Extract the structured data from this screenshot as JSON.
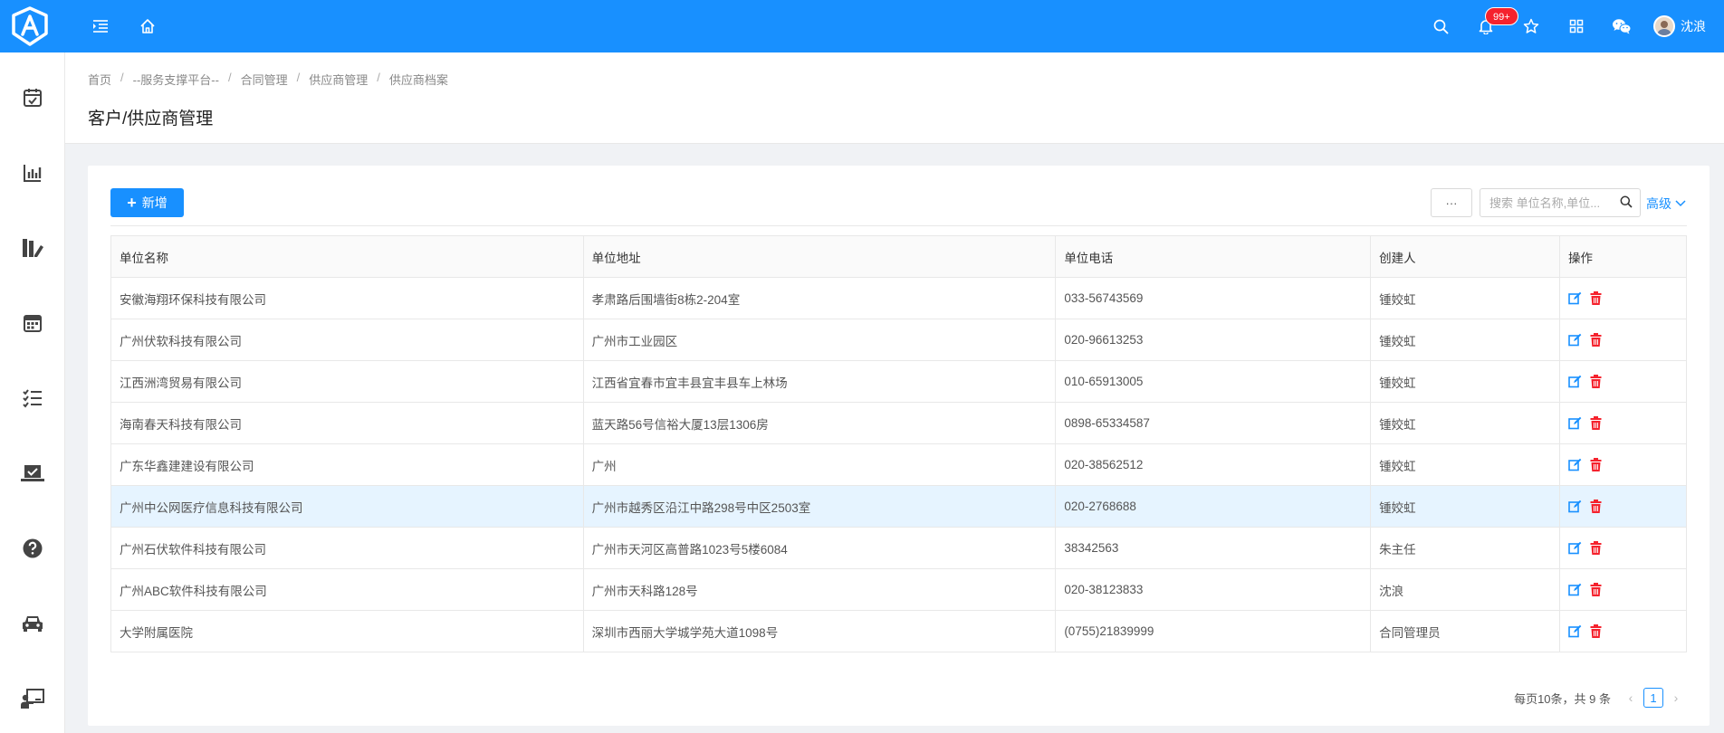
{
  "topbar": {
    "badge": "99+",
    "username": "沈浪",
    "icons": [
      "menu-fold-icon",
      "home-icon",
      "search-icon",
      "bell-icon",
      "star-icon",
      "apps-icon",
      "wechat-icon"
    ]
  },
  "sidebar": {
    "items": [
      "task-check-icon",
      "bar-chart-icon",
      "book-edit-icon",
      "calendar-icon",
      "list-check-icon",
      "laptop-check-icon",
      "help-icon",
      "car-icon",
      "teacher-icon"
    ]
  },
  "breadcrumb": [
    "首页",
    "--服务支撑平台--",
    "合同管理",
    "供应商管理",
    "供应商档案"
  ],
  "page_title": "客户/供应商管理",
  "toolbar": {
    "add_label": "新增",
    "more_label": "···",
    "search_placeholder": "搜索 单位名称,单位...",
    "advanced_label": "高级"
  },
  "table": {
    "headers": [
      "单位名称",
      "单位地址",
      "单位电话",
      "创建人",
      "操作"
    ],
    "rows": [
      {
        "name": "安徽海翔环保科技有限公司",
        "address": "孝肃路后围墙街8栋2-204室",
        "phone": "033-56743569",
        "creator": "锺姣虹"
      },
      {
        "name": "广州伏软科技有限公司",
        "address": "广州市工业园区",
        "phone": "020-96613253",
        "creator": "锺姣虹"
      },
      {
        "name": "江西洲湾贸易有限公司",
        "address": "江西省宜春市宜丰县宜丰县车上林场",
        "phone": "010-65913005",
        "creator": "锺姣虹"
      },
      {
        "name": "海南春天科技有限公司",
        "address": "蓝天路56号信裕大厦13层1306房",
        "phone": "0898-65334587",
        "creator": "锺姣虹"
      },
      {
        "name": "广东华鑫建建设有限公司",
        "address": "广州",
        "phone": "020-38562512",
        "creator": "锺姣虹"
      },
      {
        "name": "广州中公网医疗信息科技有限公司",
        "address": "广州市越秀区沿江中路298号中区2503室",
        "phone": "020-2768688",
        "creator": "锺姣虹"
      },
      {
        "name": "广州石伏软件科技有限公司",
        "address": "广州市天河区高普路1023号5楼6084",
        "phone": "38342563",
        "creator": "朱主任"
      },
      {
        "name": "广州ABC软件科技有限公司",
        "address": "广州市天科路128号",
        "phone": "020-38123833",
        "creator": "沈浪"
      },
      {
        "name": "大学附属医院",
        "address": "深圳市西丽大学城学苑大道1098号",
        "phone": "(0755)21839999",
        "creator": "合同管理员"
      }
    ],
    "highlighted_row": 5
  },
  "pagination": {
    "info": "每页10条，共 9 条",
    "current_page": "1"
  },
  "colors": {
    "primary": "#1890ff",
    "danger": "#f5222d",
    "highlight": "#e6f4ff"
  }
}
